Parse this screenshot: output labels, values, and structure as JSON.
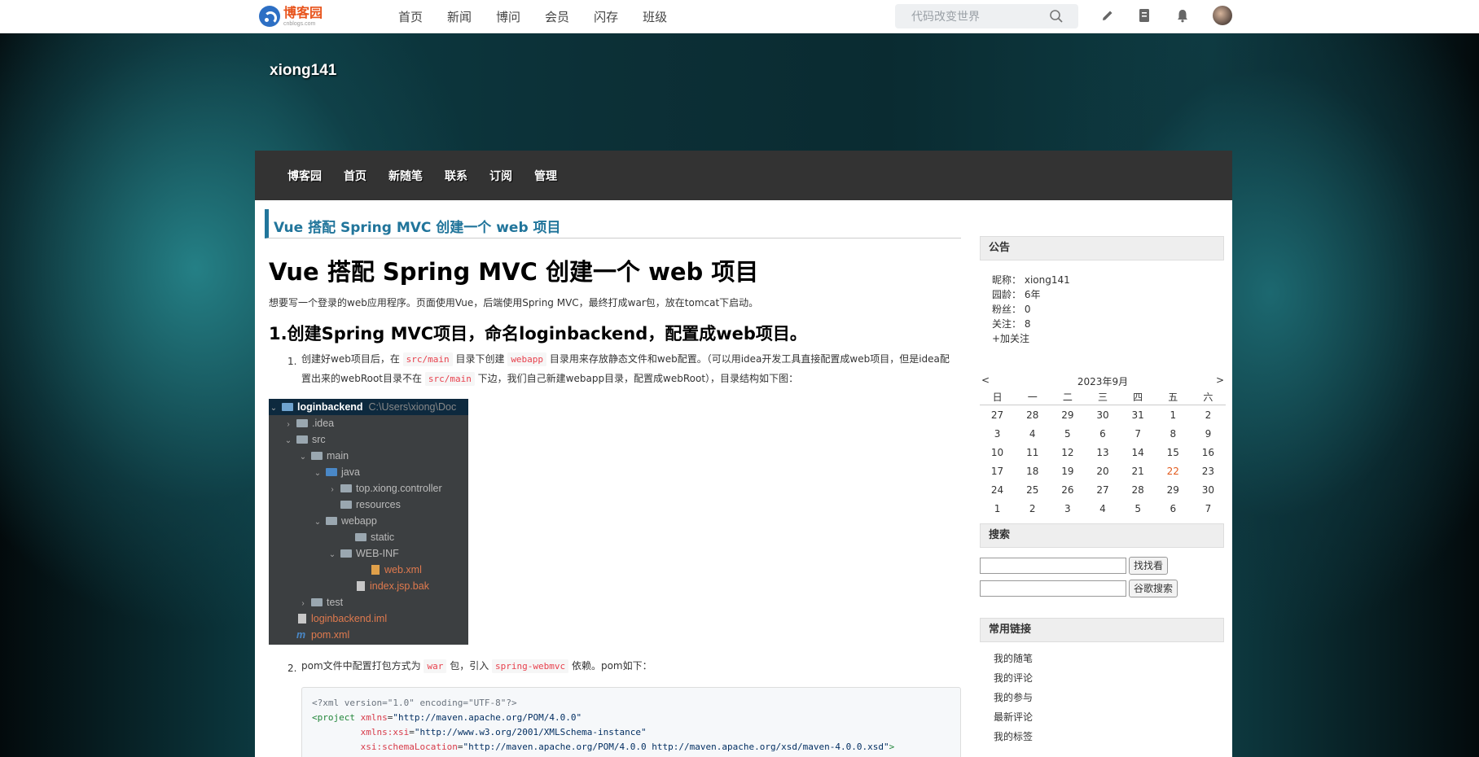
{
  "topbar": {
    "logo_name": "博客园",
    "logo_sub": "cnblogs.com",
    "nav": [
      "首页",
      "新闻",
      "博问",
      "会员",
      "闪存",
      "班级"
    ],
    "search_placeholder": "代码改变世界",
    "icons": [
      "edit-icon",
      "book-icon",
      "bell-icon"
    ]
  },
  "blog": {
    "title": "xiong141",
    "nav": [
      "博客园",
      "首页",
      "新随笔",
      "联系",
      "订阅",
      "管理"
    ]
  },
  "post": {
    "head_title": "Vue 搭配 Spring MVC 创建一个 web 项目",
    "h1": "Vue 搭配 Spring MVC 创建一个 web 项目",
    "intro": "想要写一个登录的web应用程序。页面使用Vue，后端使用Spring MVC，最终打成war包，放在tomcat下启动。",
    "h2": "1.创建Spring MVC项目，命名loginbackend，配置成web项目。",
    "step1_num": "1.",
    "step1_a": "创建好web项目后，在",
    "step1_code1": "src/main",
    "step1_b": "目录下创建",
    "step1_code2": "webapp",
    "step1_c": "目录用来存放静态文件和web配置。（可以用idea开发工具直接配置成web项目，但是idea配",
    "step1_d": "置出来的webRoot目录不在",
    "step1_code3": "src/main",
    "step1_e": "下边，我们自己新建webapp目录，配置成webRoot），目录结构如下图：",
    "step2_num": "2.",
    "step2_a": "pom文件中配置打包方式为",
    "step2_code1": "war",
    "step2_b": "包，引入",
    "step2_code2": "spring-webmvc",
    "step2_c": "依赖。pom如下：",
    "tree": {
      "root": "loginbackend",
      "root_path": "C:\\Users\\xiong\\Doc",
      "idea": ".idea",
      "src": "src",
      "main": "main",
      "java": "java",
      "controller": "top.xiong.controller",
      "resources": "resources",
      "webapp": "webapp",
      "static": "static",
      "webinf": "WEB-INF",
      "webxml": "web.xml",
      "indexbak": "index.jsp.bak",
      "test": "test",
      "iml": "loginbackend.iml",
      "pom": "pom.xml"
    },
    "code": {
      "line1": "<?xml version=\"1.0\" encoding=\"UTF-8\"?>",
      "line2_tag": "<project",
      "line2_attr": "xmlns",
      "line2_val": "\"http://maven.apache.org/POM/4.0.0\"",
      "line3_attr": "xmlns:xsi",
      "line3_val": "\"http://www.w3.org/2001/XMLSchema-instance\"",
      "line4_attr": "xsi:schemaLocation",
      "line4_val": "\"http://maven.apache.org/POM/4.0.0 http://maven.apache.org/xsd/maven-4.0.0.xsd\"",
      "line4_end": ">"
    }
  },
  "sidebar": {
    "notice_title": "公告",
    "profile": [
      {
        "label": "昵称：",
        "value": "xiong141"
      },
      {
        "label": "园龄：",
        "value": "6年"
      },
      {
        "label": "粉丝：",
        "value": "0"
      },
      {
        "label": "关注：",
        "value": "8"
      }
    ],
    "follow": "+加关注",
    "calendar": {
      "prev": "<",
      "next": ">",
      "month": "2023年9月",
      "weekdays": [
        "日",
        "一",
        "二",
        "三",
        "四",
        "五",
        "六"
      ],
      "weeks": [
        [
          "27",
          "28",
          "29",
          "30",
          "31",
          "1",
          "2"
        ],
        [
          "3",
          "4",
          "5",
          "6",
          "7",
          "8",
          "9"
        ],
        [
          "10",
          "11",
          "12",
          "13",
          "14",
          "15",
          "16"
        ],
        [
          "17",
          "18",
          "19",
          "20",
          "21",
          "22",
          "23"
        ],
        [
          "24",
          "25",
          "26",
          "27",
          "28",
          "29",
          "30"
        ],
        [
          "1",
          "2",
          "3",
          "4",
          "5",
          "6",
          "7"
        ]
      ],
      "today": "22"
    },
    "search_title": "搜索",
    "search_btn1": "找找看",
    "search_btn2": "谷歌搜索",
    "links_title": "常用链接",
    "links": [
      "我的随笔",
      "我的评论",
      "我的参与",
      "最新评论",
      "我的标签"
    ]
  },
  "colors": {
    "accent": "#21759b",
    "nav_bg": "#333333",
    "inline_code": "#e8414d",
    "today": "#e25a1c"
  }
}
